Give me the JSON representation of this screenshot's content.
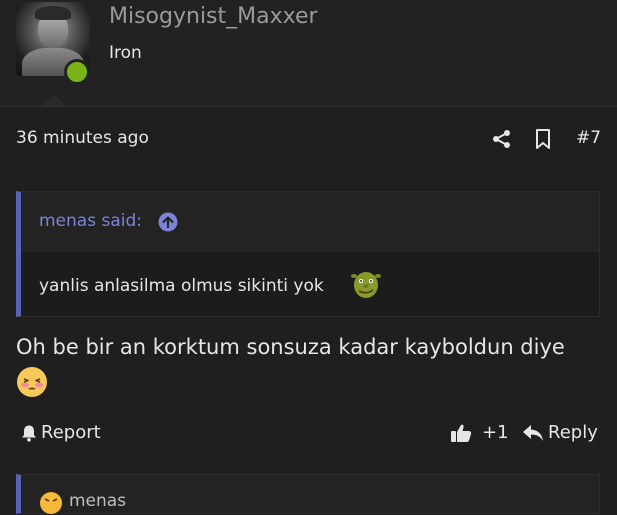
{
  "post": {
    "username": "Misogynist_Maxxer",
    "rank": "Iron",
    "time": "36 minutes ago",
    "post_number": "#7",
    "quote": {
      "author": "menas said:",
      "text": "yanlis anlasilma olmus sikinti yok"
    },
    "message": "Oh be bir an korktum sonsuza kadar kayboldun diye",
    "actions": {
      "report": "Report",
      "like_count": "+1",
      "reply": "Reply"
    },
    "next_quote_author": "menas"
  },
  "colors": {
    "background": "#1f1f1f",
    "header": "#222222",
    "quote_border": "#5a62b5",
    "quote_author": "#7a84d8",
    "online": "#7ab317"
  },
  "icons": [
    "share-icon",
    "bookmark-icon",
    "arrow-up-circle-icon",
    "shrek-emoji-icon",
    "blush-emoji-icon",
    "bell-icon",
    "thumbs-up-icon",
    "reply-arrow-icon"
  ]
}
